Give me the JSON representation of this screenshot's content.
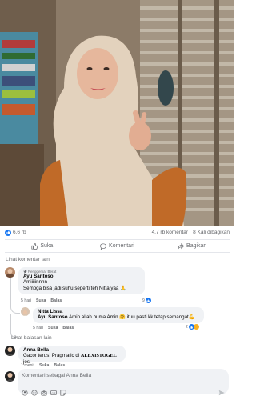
{
  "post": {
    "likes": "6,6 rb",
    "comments": "4,7 rb komentar",
    "shares": "8 Kali dibagikan"
  },
  "actions": {
    "like": "Suka",
    "comment": "Komentari",
    "share": "Bagikan"
  },
  "comments_section": {
    "see_more": "Lihat komentar lain",
    "see_more_replies": "Lihat balasan lain"
  },
  "comment1": {
    "badge": "Penggemar Berat",
    "author": "Ayu Santoso",
    "line1": "Amiiiiinnnn",
    "line2": "Semoga bisa jadi suhu seperti teh Nitta yaa 🙏",
    "time": "5 hari",
    "like": "Suka",
    "reply": "Balas",
    "reactions": "9"
  },
  "reply1": {
    "author": "Nitta Lissa",
    "mention": "Ayu Santoso",
    "text": "Amin allah huma Amin 🤗 ituu pasti kk tetap semangat💪",
    "time": "5 hari",
    "like": "Suka",
    "reply": "Balas",
    "reactions": "2"
  },
  "comment2": {
    "author": "Anna Bella",
    "text_prefix": "Gacor terus! Pragmatic di ",
    "text_brand": "ALEXISTOGEL",
    "text_suffix": " jos!",
    "time": "1 menit",
    "like": "Suka",
    "reply": "Balas"
  },
  "composer": {
    "placeholder": "Komentari sebagai Anna Bella"
  },
  "colors": {
    "accent": "#1877f2",
    "love": "#f33e58",
    "muted": "#65676b",
    "bubble": "#f0f2f5"
  },
  "icons": [
    "like-icon",
    "comment-icon",
    "share-icon",
    "sticker-icon",
    "emoji-icon",
    "camera-icon",
    "gif-icon",
    "avatar-sticker-icon",
    "send-icon"
  ]
}
